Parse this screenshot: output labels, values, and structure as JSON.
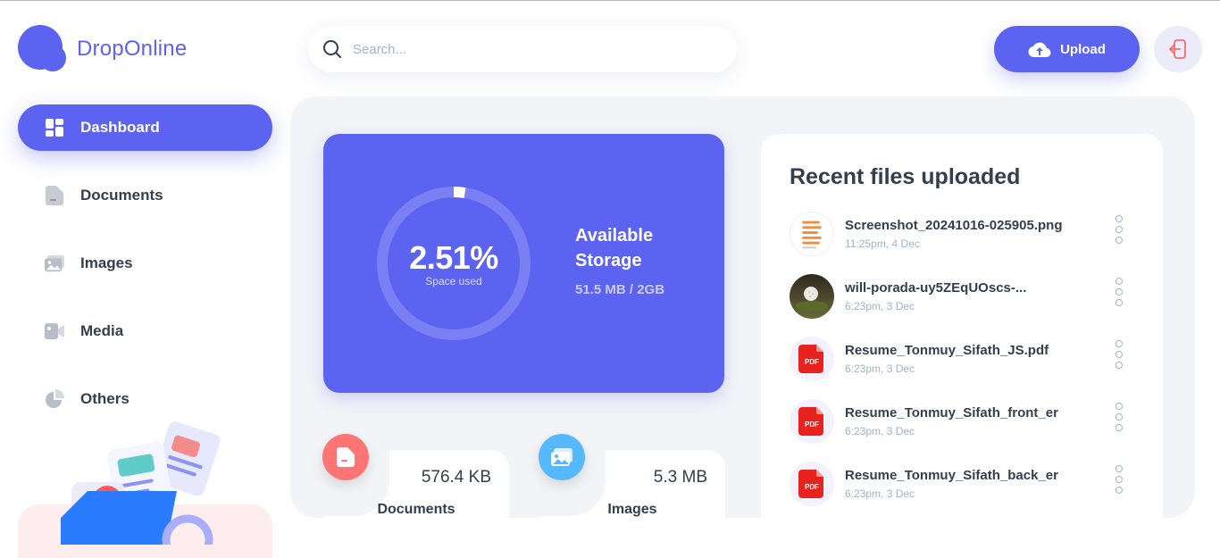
{
  "app": {
    "name": "DropOnline"
  },
  "colors": {
    "brand": "#5B63F0",
    "documents": "#FF7474",
    "images": "#56B8FF",
    "text": "#333F4E",
    "muted": "#A3B2C7"
  },
  "sidebar": {
    "items": [
      {
        "label": "Dashboard",
        "icon": "dashboard-icon",
        "active": true
      },
      {
        "label": "Documents",
        "icon": "documents-icon",
        "active": false
      },
      {
        "label": "Images",
        "icon": "images-icon",
        "active": false
      },
      {
        "label": "Media",
        "icon": "media-icon",
        "active": false
      },
      {
        "label": "Others",
        "icon": "others-icon",
        "active": false
      }
    ]
  },
  "header": {
    "search_placeholder": "Search...",
    "upload_label": "Upload",
    "logout_icon": "logout-icon"
  },
  "storage": {
    "percent_label": "2.51%",
    "percent_value": 2.51,
    "space_used_label": "Space used",
    "title": "Available Storage",
    "size": "51.5 MB / 2GB"
  },
  "categories": [
    {
      "label": "Documents",
      "size": "576.4 KB",
      "icon": "document-icon"
    },
    {
      "label": "Images",
      "size": "5.3 MB",
      "icon": "image-icon"
    }
  ],
  "recent": {
    "title": "Recent files uploaded",
    "files": [
      {
        "name": "Screenshot_20241016-025905.png",
        "date": "11:25pm, 4 Dec",
        "thumb": "screenshot-thumbnail"
      },
      {
        "name": "will-porada-uy5ZEqUOscs-...",
        "date": "6:23pm, 3 Dec",
        "thumb": "golf-ball-photo-thumbnail"
      },
      {
        "name": "Resume_Tonmuy_Sifath_JS.pdf",
        "date": "6:23pm, 3 Dec",
        "thumb": "pdf-icon"
      },
      {
        "name": "Resume_Tonmuy_Sifath_front_er",
        "date": "6:23pm, 3 Dec",
        "thumb": "pdf-icon"
      },
      {
        "name": "Resume_Tonmuy_Sifath_back_er",
        "date": "6:23pm, 3 Dec",
        "thumb": "pdf-icon"
      }
    ]
  }
}
